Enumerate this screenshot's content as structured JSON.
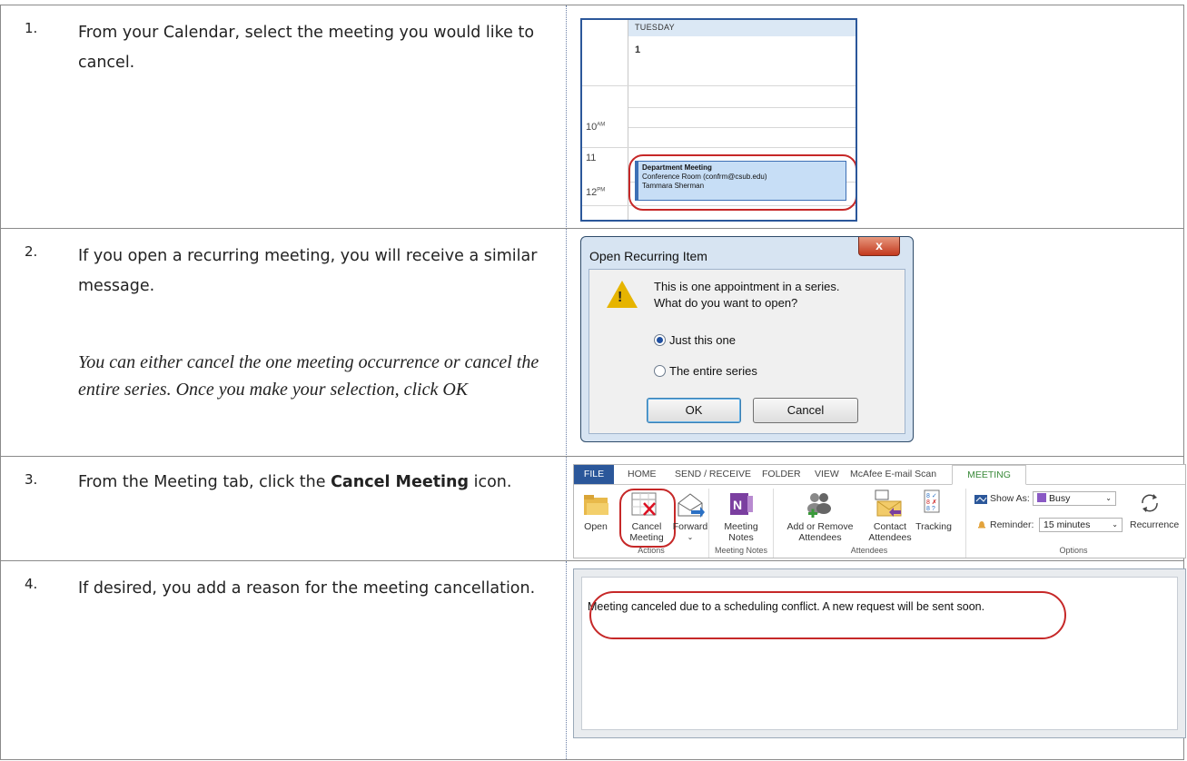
{
  "steps": [
    {
      "number": "1.",
      "text": "From your Calendar, select the meeting you would like to cancel."
    },
    {
      "number": "2.",
      "text": "If you open a recurring meeting, you will receive a similar message.",
      "note": "You can either cancel the one meeting occurrence or cancel the entire series.  Once you make your selection, click OK"
    },
    {
      "number": "3.",
      "text_before": "From the Meeting tab, click the ",
      "text_bold": "Cancel Meeting",
      "text_after": " icon."
    },
    {
      "number": "4.",
      "text": "If desired, you add a reason for the meeting cancellation."
    }
  ],
  "calendar": {
    "day_label": "TUESDAY",
    "day_number": "1",
    "hours": [
      {
        "hour": "10",
        "suffix": "AM"
      },
      {
        "hour": "11",
        "suffix": ""
      },
      {
        "hour": "12",
        "suffix": "PM"
      }
    ],
    "event": {
      "title": "Department Meeting",
      "location": "Conference Room (confrm@csub.edu)",
      "organizer": "Tammara Sherman"
    },
    "colors": {
      "accent": "#2b579a",
      "event_fill": "#c7def6",
      "highlight": "#c62828"
    }
  },
  "dialog": {
    "title": "Open Recurring Item",
    "close_glyph": "x",
    "message_line1": "This is one appointment in a series.",
    "message_line2": "What do you want to open?",
    "options": [
      {
        "label": "Just this one",
        "selected": true
      },
      {
        "label": "The entire series",
        "selected": false
      }
    ],
    "ok_label": "OK",
    "cancel_label": "Cancel",
    "icon": "warning-icon"
  },
  "ribbon": {
    "tabs": [
      "FILE",
      "HOME",
      "SEND / RECEIVE",
      "FOLDER",
      "VIEW",
      "McAfee E-mail Scan",
      "MEETING"
    ],
    "active_tab": "MEETING",
    "buttons": {
      "open": "Open",
      "cancel_line1": "Cancel",
      "cancel_line2": "Meeting",
      "forward": "Forward",
      "meeting_notes_line1": "Meeting",
      "meeting_notes_line2": "Notes",
      "add_remove_line1": "Add or Remove",
      "add_remove_line2": "Attendees",
      "contact_line1": "Contact",
      "contact_line2": "Attendees",
      "tracking": "Tracking",
      "show_as_label": "Show As:",
      "show_as_value": "Busy",
      "reminder_label": "Reminder:",
      "reminder_value": "15 minutes",
      "recurrence": "Recurrence"
    },
    "groups": [
      "Actions",
      "Meeting Notes",
      "Attendees",
      "Options"
    ]
  },
  "note_editor": {
    "text": "Meeting canceled due to a scheduling conflict. A new request will be sent soon."
  }
}
